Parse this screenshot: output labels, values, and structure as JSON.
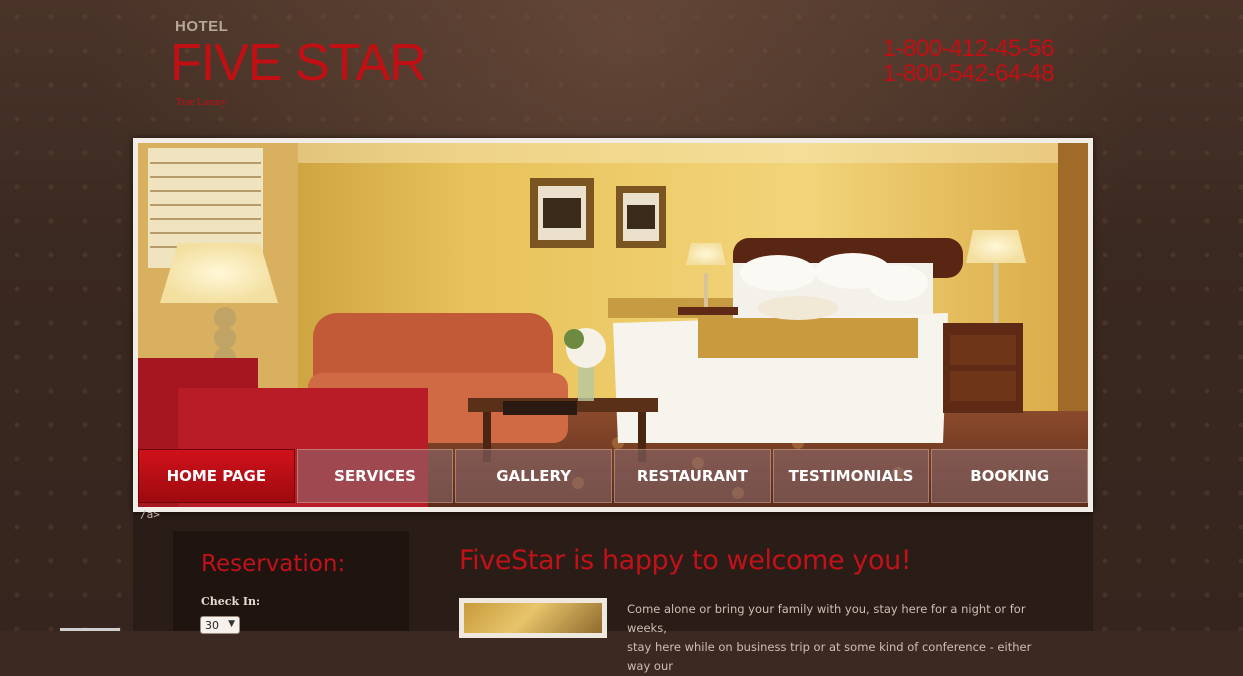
{
  "header": {
    "logo_small": "HOTEL",
    "logo_name": "FIVE STAR",
    "tagline": "True Luxury",
    "phones": [
      "1-800-412-45-56",
      "1-800-542-64-48"
    ]
  },
  "nav": {
    "items": [
      {
        "label": "HOME PAGE",
        "active": true
      },
      {
        "label": "SERVICES",
        "active": false
      },
      {
        "label": "GALLERY",
        "active": false
      },
      {
        "label": "RESTAURANT",
        "active": false
      },
      {
        "label": "TESTIMONIALS",
        "active": false
      },
      {
        "label": "BOOKING",
        "active": false
      }
    ]
  },
  "stray_text": "/a>",
  "sidebar": {
    "title": "Reservation:",
    "checkin_label": "Check In:",
    "checkin_day": "30"
  },
  "main": {
    "title": "FiveStar is happy to welcome you!",
    "intro_lines": [
      "Come alone or bring your family with you, stay here for a night or for weeks,",
      "stay here while on business trip or at some kind of conference - either way our"
    ]
  },
  "colors": {
    "accent": "#c10f14",
    "background": "#3c2a22",
    "content": "#2a1c16"
  }
}
